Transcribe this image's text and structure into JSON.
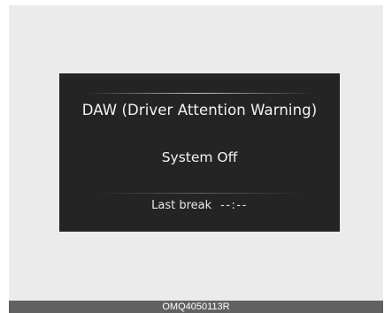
{
  "display": {
    "title": "DAW (Driver Attention Warning)",
    "status": "System Off",
    "last_break_label": "Last break",
    "last_break_value": "--:--"
  },
  "caption": {
    "code": "OMQ4050113R"
  },
  "colors": {
    "display_background": "#242424",
    "frame_background": "#ebebeb",
    "caption_background": "#616161",
    "text": "#f2f2f2"
  }
}
